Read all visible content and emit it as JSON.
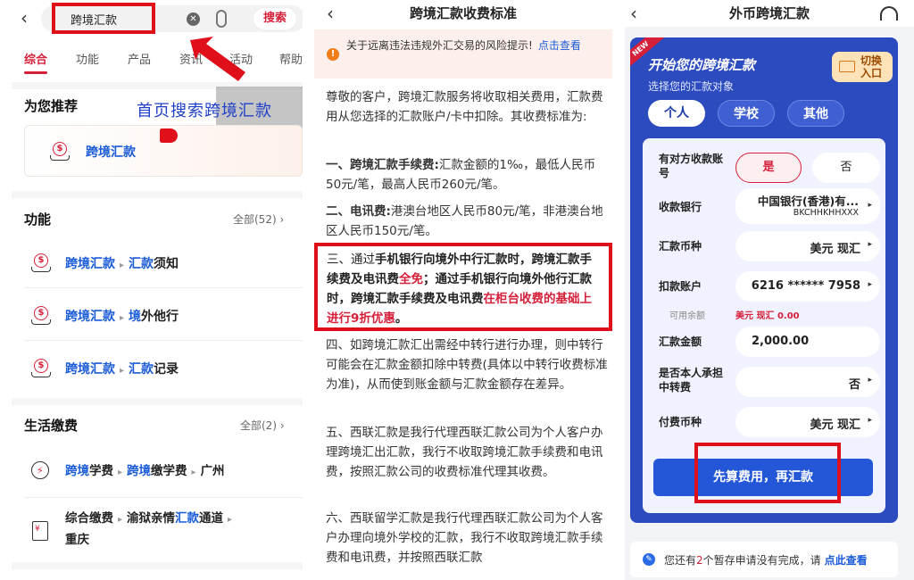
{
  "search_screen": {
    "back_glyph": "‹",
    "search_value": "跨境汇款",
    "search_button": "搜索",
    "tabs": [
      "综合",
      "功能",
      "产品",
      "资讯",
      "活动",
      "帮助"
    ],
    "annotation": "首页搜索跨境汇款",
    "recommend_title": "为您推荐",
    "recommend_item": "跨境汇款",
    "functions_title": "功能",
    "functions_more": "全部(52) ›",
    "functions": [
      {
        "a": "跨境汇款",
        "b1": "汇款",
        "b2": "须知"
      },
      {
        "a": "跨境汇款",
        "b1": "境",
        "b2": "外他行"
      },
      {
        "a": "跨境汇款",
        "b1": "汇款",
        "b2": "记录"
      }
    ],
    "life_title": "生活缴费",
    "life_more": "全部(2) ›",
    "life_item1": {
      "a": "跨境",
      "b": "学费",
      "c": "跨境",
      "d": "缴学费",
      "e": "广州"
    },
    "life_item2": {
      "a": "综合缴费",
      "b": "渝狱亲情",
      "c": "汇款",
      "d": "通道",
      "e": "重庆"
    }
  },
  "fee_screen": {
    "title": "跨境汇款收费标准",
    "notice_text": "关于远离违法违规外汇交易的风险提示!",
    "notice_link": "点击查看",
    "intro": "尊敬的客户，跨境汇款服务将收取相关费用，汇款费用从您选择的汇款账户/卡中扣除。其收费标准为:",
    "p1_label": "一、跨境汇款手续费:",
    "p1_text": "汇款金额的1‰，最低人民币50元/笔，最高人民币260元/笔。",
    "p2_label": "二、电讯费:",
    "p2_text": "港澳台地区人民币80元/笔，非港澳台地区人民币150元/笔。",
    "p3_a": "三、通过",
    "p3_b": "手机银行向境外中行汇款时，跨境汇款手续费及电讯费",
    "p3_c": "全免",
    "p3_d": "；通过手机银行向境外他行汇款时，跨境汇款手续费及电讯费",
    "p3_e": "在柜台收费的基础上进行9折优惠",
    "p3_f": "。",
    "p4": "四、如跨境汇款汇出需经中转行进行办理，则中转行可能会在汇款金额扣除中转费(具体以中转行收费标准为准)，从而使到账金额与汇款金额存在差异。",
    "p5": "五、西联汇款是我行代理西联汇款公司为个人客户办理跨境汇出汇款，我行不收取跨境汇款手续费和电讯费，按照汇款公司的收费标准代理其收费。",
    "p6": "六、西联留学汇款是我行代理西联汇款公司为个人客户办理向境外学校的汇款，我行不收取跨境汇款手续费和电讯费，并按照西联汇款"
  },
  "remit_screen": {
    "title": "外币跨境汇款",
    "new_tag": "NEW",
    "card_title": "开始您的跨境汇款",
    "card_subtitle": "选择您的汇款对象",
    "switch_line1": "切换",
    "switch_line2": "入口",
    "targets": [
      "个人",
      "学校",
      "其他"
    ],
    "has_account_label": "有对方收款账号",
    "yes": "是",
    "no": "否",
    "bank_label": "收款银行",
    "bank_name": "中国银行(香港)有...",
    "bank_code": "BKCHHKHHXXX",
    "currency_label": "汇款币种",
    "currency_value": "美元 现汇",
    "debit_label": "扣款账户",
    "debit_value": "6216 ****** 7958",
    "avail_label": "可用余额",
    "avail_value": "美元 现汇 0.00",
    "amount_label": "汇款金额",
    "amount_value": "2,000.00",
    "intermediary_label": "是否本人承担中转费",
    "intermediary_value": "否",
    "pay_currency_label": "付费币种",
    "pay_currency_value": "美元 现汇",
    "calc_button": "先算费用，再汇款",
    "pending_a": "您还有",
    "pending_count": "2",
    "pending_b": "个暂存申请没有完成，请",
    "pending_link": "点此查看"
  }
}
